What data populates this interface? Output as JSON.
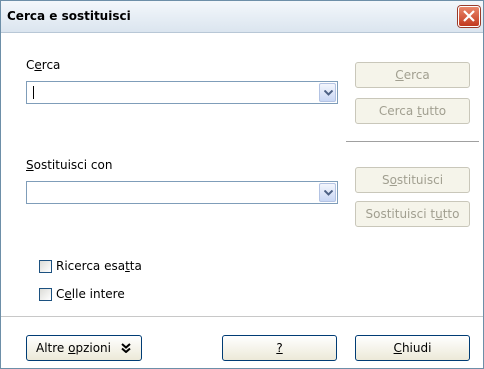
{
  "window": {
    "title": "Cerca e sostituisci"
  },
  "search": {
    "label_pre": "C",
    "label_u": "e",
    "label_post": "rca",
    "value": ""
  },
  "replace": {
    "label_pre": "",
    "label_u": "S",
    "label_post": "ostituisci con",
    "value": ""
  },
  "buttons": {
    "find": {
      "pre": "",
      "u": "C",
      "post": "erca"
    },
    "find_all": {
      "pre": "Cerca ",
      "u": "t",
      "post": "utto"
    },
    "replace": {
      "pre": "S",
      "u": "o",
      "post": "stituisci"
    },
    "replace_all": {
      "pre": "Sostituisci t",
      "u": "u",
      "post": "tto"
    },
    "more_options": {
      "pre": "Altre ",
      "u": "o",
      "post": "pzioni"
    },
    "help": {
      "pre": "",
      "u": "?",
      "post": ""
    },
    "close": {
      "pre": "",
      "u": "C",
      "post": "hiudi"
    }
  },
  "options": {
    "match_case": {
      "pre": "Ricerca esa",
      "u": "t",
      "post": "ta",
      "checked": false
    },
    "whole_cells": {
      "pre": "C",
      "u": "e",
      "post": "lle intere",
      "checked": false
    }
  },
  "colors": {
    "titlebar": "#dbe5ef",
    "close": "#c2391f",
    "disabled_text": "#a19f90"
  }
}
